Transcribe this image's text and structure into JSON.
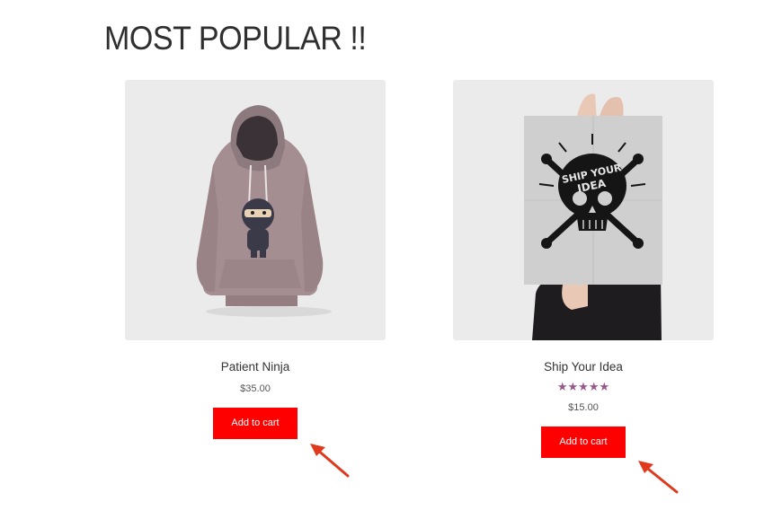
{
  "section": {
    "title": "MOST POPULAR !!"
  },
  "products": [
    {
      "name": "Patient Ninja",
      "price": "$35.00",
      "rating": null,
      "button_label": "Add to cart",
      "image_icon": "hoodie-image"
    },
    {
      "name": "Ship Your Idea",
      "price": "$15.00",
      "rating": {
        "stars": 5,
        "max": 5,
        "display": "★★★★★"
      },
      "button_label": "Add to cart",
      "image_icon": "poster-image",
      "image_text": [
        "SHIP YOUR",
        "IDEA"
      ]
    }
  ],
  "colors": {
    "button": "#ff0000",
    "rating": "#96588a",
    "arrow": "#e03a1e",
    "thumb_bg": "#ebebeb"
  }
}
